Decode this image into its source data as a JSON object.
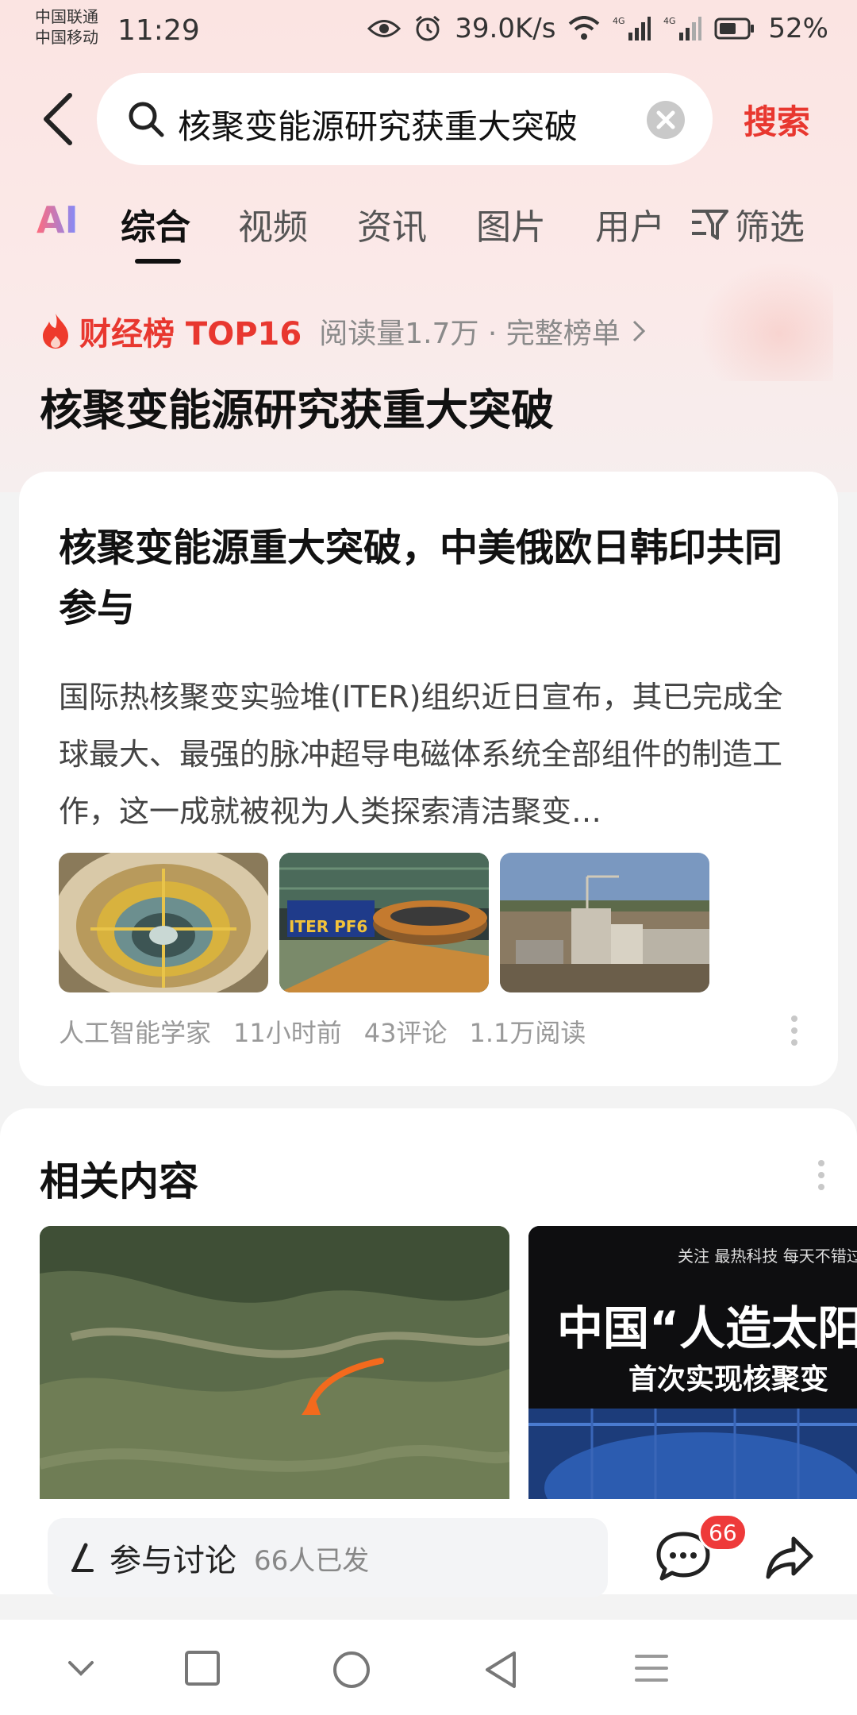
{
  "status_bar": {
    "carrier_1": "中国联通",
    "carrier_2": "中国移动",
    "time": "11:29",
    "net_speed": "39.0K/s",
    "battery": "52%"
  },
  "search": {
    "query": "核聚变能源研究获重大突破",
    "submit_label": "搜索"
  },
  "tabs": {
    "ai": "AI",
    "items": [
      "综合",
      "视频",
      "资讯",
      "图片",
      "用户"
    ],
    "active": "综合",
    "filter_label": "筛选"
  },
  "ranking": {
    "label": "财经榜 TOP16",
    "meta": "阅读量1.7万 · 完整榜单"
  },
  "topic": {
    "title": "核聚变能源研究获重大突破"
  },
  "article": {
    "title": "核聚变能源重大突破，中美俄欧日韩印共同参与",
    "summary": "国际热核聚变实验堆(ITER)组织近日宣布，其已完成全球最大、最强的脉冲超导电磁体系统全部组件的制造工作，这一成就被视为人类探索清洁聚变…",
    "images": [
      "tokamak-interior",
      "iter-pf6-coil",
      "construction-site"
    ],
    "image2_label": "ITER PF6",
    "author": "人工智能学家",
    "time": "11小时前",
    "comments": "43评论",
    "reads": "1.1万阅读"
  },
  "related": {
    "title": "相关内容",
    "card2": {
      "tagline": "关注 最热科技 每天不错过",
      "headline": "中国“人造太阳",
      "subline": "首次实现核聚变"
    }
  },
  "action_bar": {
    "discuss_label": "参与讨论",
    "discuss_count": "66人已发",
    "comment_badge": "66"
  },
  "colors": {
    "accent": "#e8372f",
    "badge": "#ee3a3a"
  }
}
